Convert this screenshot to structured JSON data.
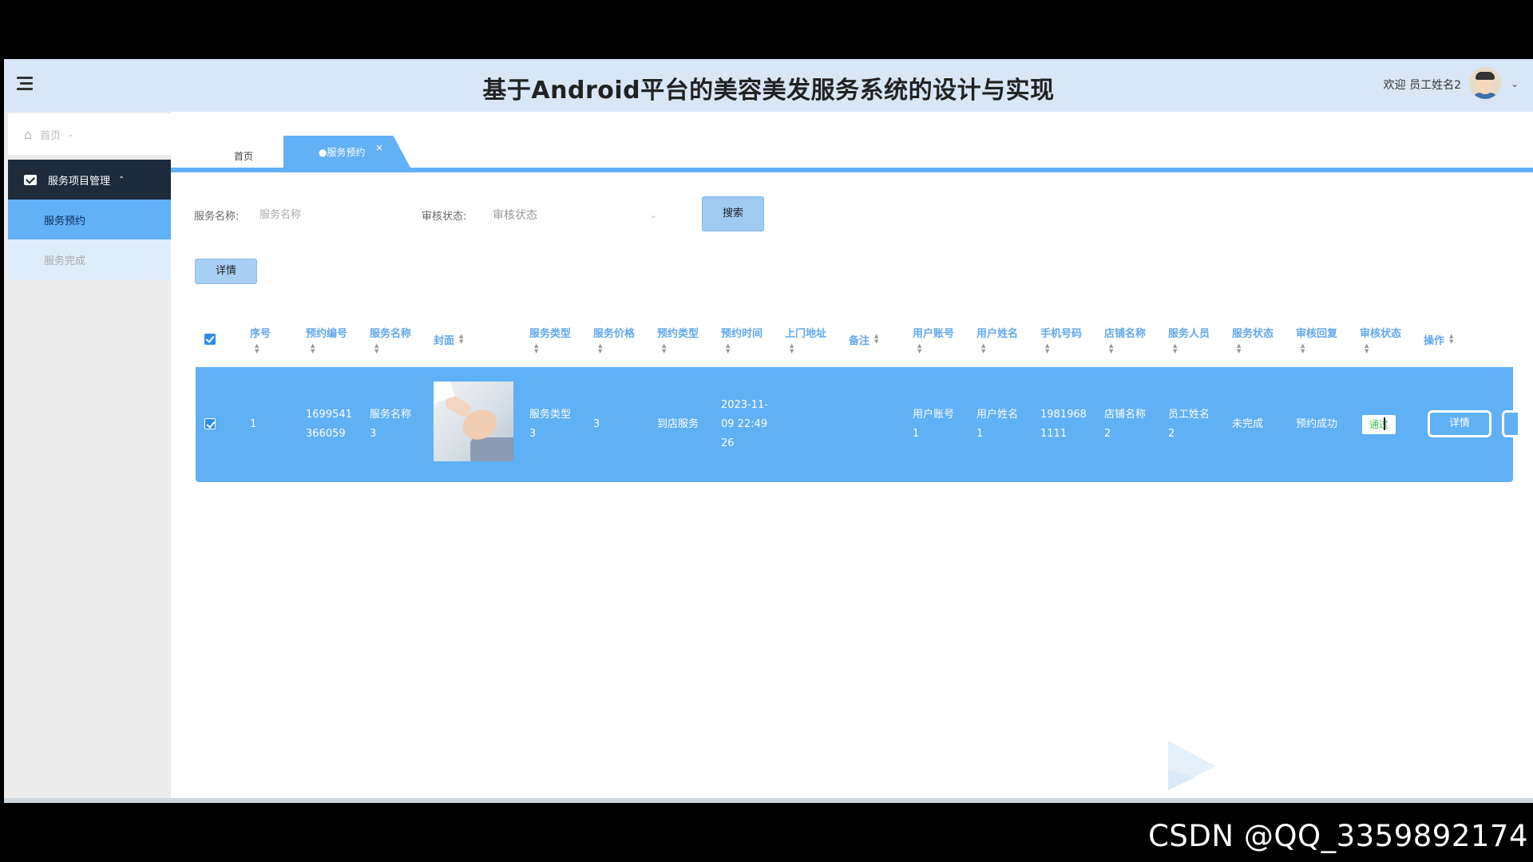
{
  "header": {
    "title": "基于Android平台的美容美发服务系统的设计与实现",
    "welcome": "欢迎 员工姓名2"
  },
  "sidebar": {
    "home": "首页",
    "group": "服务项目管理",
    "items": [
      "服务预约",
      "服务完成"
    ]
  },
  "tabs": {
    "home": "首页",
    "active": "●服务预约",
    "close": "×"
  },
  "search": {
    "name_label": "服务名称:",
    "name_placeholder": "服务名称",
    "status_label": "审核状态:",
    "status_placeholder": "审核状态",
    "search_button": "搜索"
  },
  "toolbar": {
    "detail_button": "详情"
  },
  "table": {
    "columns": [
      "序号",
      "预约编号",
      "服务名称",
      "封面",
      "服务类型",
      "服务价格",
      "预约类型",
      "预约时间",
      "上门地址",
      "备注",
      "用户账号",
      "用户姓名",
      "手机号码",
      "店铺名称",
      "服务人员",
      "服务状态",
      "审核回复",
      "审核状态",
      "操作"
    ],
    "row": {
      "index": "1",
      "booking_no": "1699541\n366059",
      "service_name": "服务名称\n3",
      "service_type": "服务类型\n3",
      "price": "3",
      "booking_type": "到店服务",
      "booking_time": "2023-11-\n09 22:49\n26",
      "address": "",
      "remark": "",
      "user_account": "用户账号\n1",
      "user_name": "用户姓名\n1",
      "phone": "1981968\n1111",
      "shop_name": "店铺名称\n2",
      "staff": "员工姓名\n2",
      "service_status": "未完成",
      "review_reply": "预约成功",
      "review_status": "通过",
      "action_detail": "详情"
    }
  },
  "watermark": "CSDN @QQ_3359892174",
  "colors": {
    "accent": "#62b0f6",
    "row": "#5fb0f5",
    "sidebar_dark": "#1d2b3b",
    "header": "#d9e6f5"
  }
}
